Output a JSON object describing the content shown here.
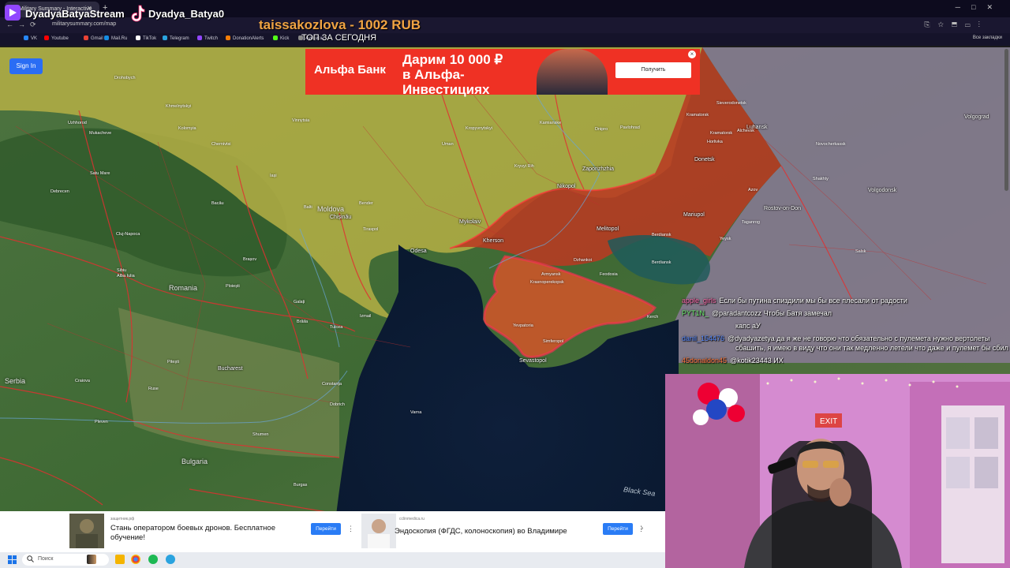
{
  "browser": {
    "tab_title": "Military Summary - Interactive",
    "url": "militarysummary.com/map",
    "bookmarks": [
      {
        "label": "VK",
        "color": "#2787f5"
      },
      {
        "label": "Youtube",
        "color": "#ff0000"
      },
      {
        "label": "Gmail",
        "color": "#ea4335"
      },
      {
        "label": "Mail.Ru",
        "color": "#168de2"
      },
      {
        "label": "TikTok",
        "color": "#ffffff"
      },
      {
        "label": "Telegram",
        "color": "#2aa3df"
      },
      {
        "label": "Twitch",
        "color": "#9146ff"
      },
      {
        "label": "DonationAlerts",
        "color": "#f57d07"
      },
      {
        "label": "Kick",
        "color": "#53fc18"
      },
      {
        "label": "Аукцион",
        "color": "#888888"
      }
    ],
    "all_bookmarks": "Все закладки"
  },
  "stream": {
    "channel_name": "DyadyaBatyaStream",
    "tiktok_name": "Dyadya_Batya0",
    "donation": "taissakozlova - 1002 RUB",
    "top_today": "ТОП ЗА СЕГОДНЯ"
  },
  "site": {
    "signin_label": "Sign In"
  },
  "map": {
    "countries": [
      {
        "label": "Romania"
      },
      {
        "label": "Serbia"
      },
      {
        "label": "Bulgaria"
      },
      {
        "label": "Moldova"
      }
    ],
    "sea_label": "Black Sea",
    "cities": [
      "Odesa",
      "Kherson",
      "Melitopol",
      "Mariupol",
      "Donetsk",
      "Luhansk",
      "Berdiansk",
      "Zaporizhzhia",
      "Nikopol",
      "Dnipro",
      "Kryvyi Rih",
      "Mykolaiv",
      "Sevastopol",
      "Simferopol",
      "Kerch",
      "Yevpatoria",
      "Bucharest",
      "Chișinău",
      "Constanța",
      "Varna",
      "Tiraspol",
      "Volgodonsk",
      "Rostov-on-Don",
      "Volgograd",
      "Kamianske",
      "Pavlohrad",
      "Horlivka",
      "Kramatorsk",
      "Sieverodonetsk",
      "Alchevsk",
      "Kropyvnytskyi",
      "Uman",
      "Kolomyia",
      "Chernivtsi",
      "Iași",
      "Bacău",
      "Cluj-Napoca",
      "Brașov",
      "Ploiești",
      "Galați",
      "Brăila",
      "Tulcea",
      "Craiova",
      "Pitești",
      "Ruse",
      "Shumen",
      "Pleven",
      "Dobrich",
      "Burgas",
      "Sibiu",
      "Alba Iulia",
      "Debrecen",
      "Satu Mare",
      "Uzhhorod",
      "Mukacheve",
      "Drohobych",
      "Khmelnytskyi",
      "Vinnytsia",
      "Balti",
      "Bender",
      "Izmail",
      "Kramatorsk",
      "Shakhty",
      "Novocherkassk",
      "Taganrog",
      "Salsk",
      "Yeysk",
      "Azov",
      "Berdiansk",
      "Feodosia",
      "Dzhankoi",
      "Armyansk",
      "Krasnoperekopsk"
    ]
  },
  "ads": {
    "top_banner": {
      "brand": "Альфа Банк",
      "headline": "Дарим 10 000 ₽\nв Альфа-\nИнвестициях",
      "button": "Получить"
    },
    "bottom": [
      {
        "source": "защитник.рф",
        "title": "Стань оператором боевых дронов. Бесплатное обучение!",
        "button": "Перейти"
      },
      {
        "source": "cclinmedica.ru",
        "title": "Эндоскопия (ФГДС, колоноскопия) во Владимире",
        "button": "Перейти"
      }
    ]
  },
  "chat": [
    {
      "user": "apple_girls",
      "user_color": "#ff6fae",
      "text": "Если бы путина спиздили мы бы все плесали от радости"
    },
    {
      "user": "PYT1N_",
      "user_color": "#6cf06c",
      "text": "@paradantcozz Чтобы Батя замечал"
    },
    {
      "user": "",
      "user_color": "#ffffff",
      "text": "капс аУ"
    },
    {
      "user": "danil_154476",
      "user_color": "#5a8cff",
      "text": "@dyadyazetya да я же не говорю что обязательно с пулемета нужно вертолеты"
    },
    {
      "user": "",
      "user_color": "#ffffff",
      "text": "сбашить, я имею в виду что они так медленно летели что даже и пулемет бы сбил"
    },
    {
      "user": "45donaldon45",
      "user_color": "#ff7a3c",
      "text": "@kotik23443 ИХ"
    }
  ],
  "taskbar": {
    "search_placeholder": "Поиск"
  }
}
